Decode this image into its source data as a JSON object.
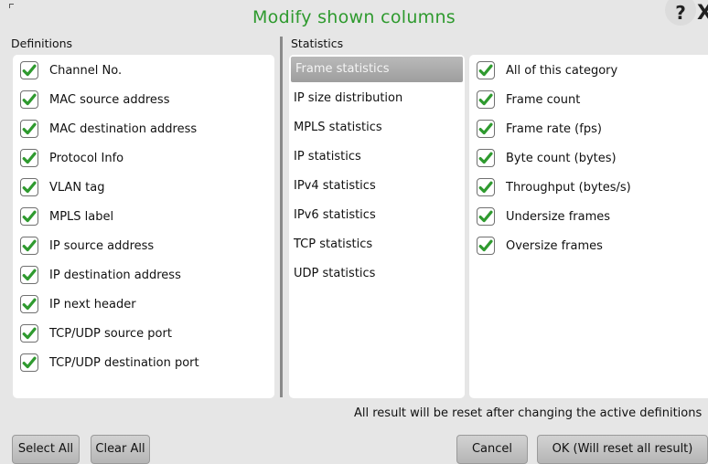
{
  "dialog": {
    "title": "Modify shown columns"
  },
  "sections": {
    "definitions": "Definitions",
    "statistics": "Statistics"
  },
  "definitions": [
    {
      "label": "Channel No.",
      "checked": true
    },
    {
      "label": "MAC source address",
      "checked": true
    },
    {
      "label": "MAC destination address",
      "checked": true
    },
    {
      "label": "Protocol Info",
      "checked": true
    },
    {
      "label": "VLAN tag",
      "checked": true
    },
    {
      "label": "MPLS label",
      "checked": true
    },
    {
      "label": "IP source address",
      "checked": true
    },
    {
      "label": "IP destination address",
      "checked": true
    },
    {
      "label": "IP next header",
      "checked": true
    },
    {
      "label": "TCP/UDP source port",
      "checked": true
    },
    {
      "label": "TCP/UDP destination port",
      "checked": true
    }
  ],
  "categories": [
    {
      "label": "Frame statistics",
      "selected": true
    },
    {
      "label": "IP size distribution",
      "selected": false
    },
    {
      "label": "MPLS statistics",
      "selected": false
    },
    {
      "label": "IP statistics",
      "selected": false
    },
    {
      "label": "IPv4 statistics",
      "selected": false
    },
    {
      "label": "IPv6 statistics",
      "selected": false
    },
    {
      "label": "TCP statistics",
      "selected": false
    },
    {
      "label": "UDP statistics",
      "selected": false
    }
  ],
  "stats": [
    {
      "label": "All of this category",
      "checked": true
    },
    {
      "label": "Frame count",
      "checked": true
    },
    {
      "label": "Frame rate (fps)",
      "checked": true
    },
    {
      "label": "Byte count (bytes)",
      "checked": true
    },
    {
      "label": "Throughput (bytes/s)",
      "checked": true
    },
    {
      "label": "Undersize frames",
      "checked": true
    },
    {
      "label": "Oversize frames",
      "checked": true
    }
  ],
  "notice": "All result will be reset after changing the active definitions",
  "buttons": {
    "select_all": "Select All",
    "clear_all": "Clear All",
    "cancel": "Cancel",
    "ok": "OK (Will reset all result)"
  },
  "icons": {
    "help": "?",
    "close": "X",
    "check": "check-icon"
  },
  "colors": {
    "title": "#2e9a2e",
    "check": "#2f9a2f",
    "selected_bg": "#a9a9a9"
  }
}
